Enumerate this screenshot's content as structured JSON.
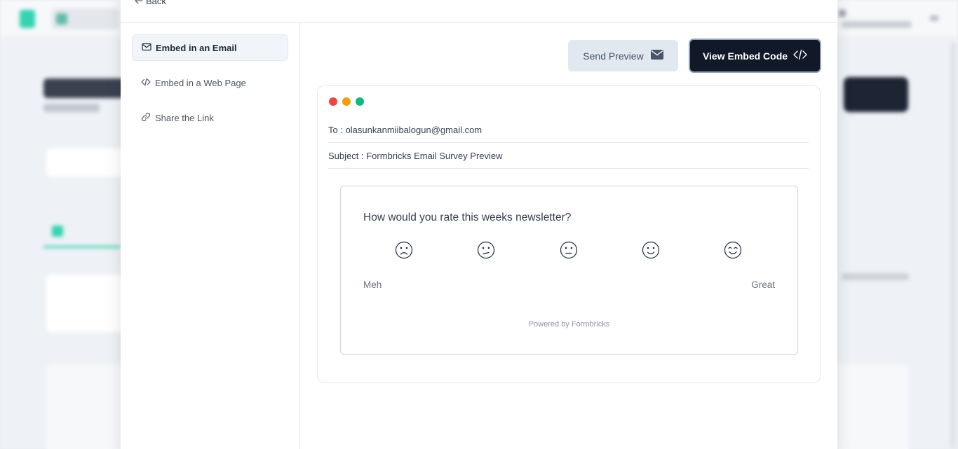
{
  "background": {
    "app_name": "",
    "title": "",
    "subtitle": ""
  },
  "modal": {
    "back_label": "Back",
    "sidebar": [
      {
        "label": "Embed in an Email",
        "icon": "mail-icon",
        "active": true
      },
      {
        "label": "Embed in a Web Page",
        "icon": "code-icon",
        "active": false
      },
      {
        "label": "Share the Link",
        "icon": "link-icon",
        "active": false
      }
    ],
    "buttons": {
      "send_preview": "Send Preview",
      "view_embed_code": "View Embed Code"
    },
    "email": {
      "to": "To : olasunkanmiibalogun@gmail.com",
      "subject": "Subject : Formbricks Email Survey Preview",
      "window_dots": [
        "#ef4444",
        "#f59e0b",
        "#10b981"
      ]
    },
    "survey": {
      "question": "How would you rate this weeks newsletter?",
      "faces": [
        "frown-face-icon",
        "confused-face-icon",
        "neutral-face-icon",
        "slight-smile-face-icon",
        "happy-face-icon"
      ],
      "lower_label": "Meh",
      "upper_label": "Great",
      "powered_by": "Powered by Formbricks"
    }
  },
  "colors": {
    "accent_dark": "#111827",
    "brand_green": "#34d3b1"
  }
}
